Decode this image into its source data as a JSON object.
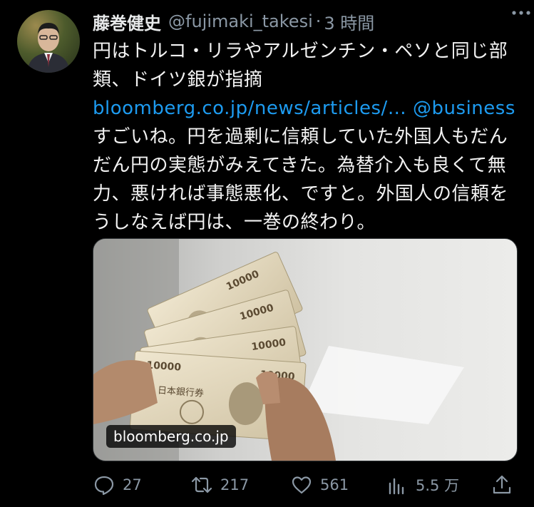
{
  "author": {
    "name": "藤巻健史",
    "handle": "@fujimaki_takesi",
    "separator": "·",
    "time": "3 時間"
  },
  "tweet": {
    "text_1": "円はトルコ・リラやアルゼンチン・ペソと同じ部類、ドイツ銀が指摘 ",
    "link_1": "bloomberg.co.jp/news/articles/…",
    "mention": "@business",
    "text_2": "  すごいね。円を過剰に信頼していた外国人もだんだん円の実態がみえてきた。為替介入も良くて無力、悪ければ事態悪化、ですと。外国人の信頼をうしなえば円は、一巻の終わり。"
  },
  "media": {
    "caption": "bloomberg.co.jp",
    "banknote_value": "10000",
    "banknote_text": "日本銀行券"
  },
  "actions": {
    "replies": "27",
    "retweets": "217",
    "likes": "561",
    "views": "5.5 万"
  },
  "colors": {
    "background": "#000000",
    "text": "#e7e9ea",
    "muted": "#8b98a5",
    "link": "#1d9bf0"
  },
  "icons": {
    "avatar": "profile-photo",
    "more": "more-icon",
    "reply": "reply-icon",
    "retweet": "retweet-icon",
    "like": "heart-icon",
    "views": "views-icon",
    "share": "share-icon"
  }
}
